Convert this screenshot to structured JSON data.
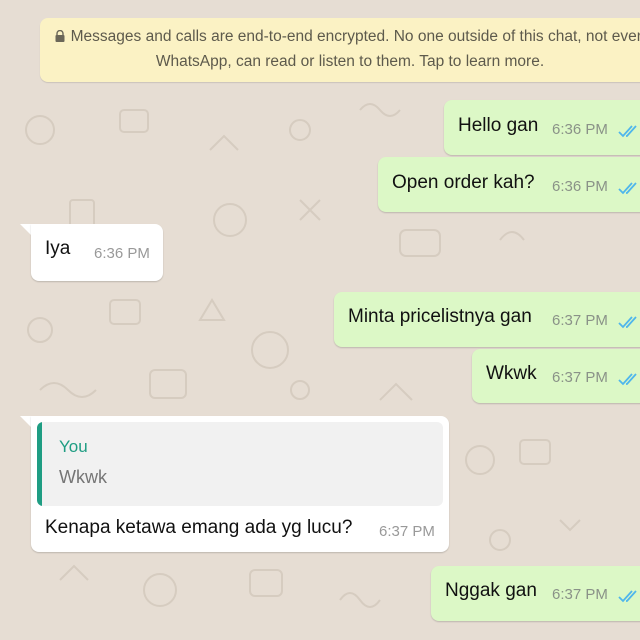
{
  "encryption_notice": {
    "line1": "Messages and calls are end-to-end encrypted. No one outside of this chat, not even",
    "line2": "WhatsApp, can read or listen to them. Tap to learn more.",
    "icon": "lock-icon"
  },
  "colors": {
    "outgoing_bubble": "#dcf8c6",
    "incoming_bubble": "#ffffff",
    "read_ticks": "#4fb6ec",
    "quote_accent": "#1f9d83",
    "wallpaper": "#e6ddd3"
  },
  "messages": [
    {
      "direction": "outgoing",
      "text": "Hello gan",
      "time": "6:36 PM",
      "status": "read"
    },
    {
      "direction": "outgoing",
      "text": "Open order kah?",
      "time": "6:36 PM",
      "status": "read"
    },
    {
      "direction": "incoming",
      "text": "Iya",
      "time": "6:36 PM"
    },
    {
      "direction": "outgoing",
      "text": "Minta pricelistnya gan",
      "time": "6:37 PM",
      "status": "read"
    },
    {
      "direction": "outgoing",
      "text": "Wkwk",
      "time": "6:37 PM",
      "status": "read"
    },
    {
      "direction": "incoming",
      "text": "Kenapa ketawa emang ada yg lucu?",
      "time": "6:37 PM",
      "reply_to": {
        "author": "You",
        "text": "Wkwk"
      }
    },
    {
      "direction": "outgoing",
      "text": "Nggak gan",
      "time": "6:37 PM",
      "status": "read"
    }
  ]
}
